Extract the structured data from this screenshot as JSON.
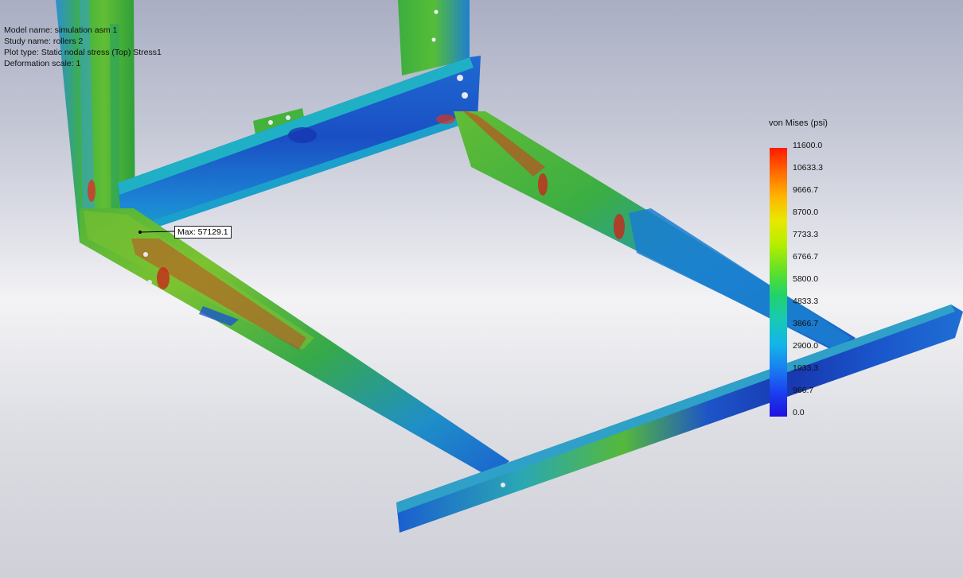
{
  "info": {
    "model_name": "Model name: simulation asm 1",
    "study_name": "Study name: rollers 2",
    "plot_type": "Plot type: Static nodal stress (Top) Stress1",
    "deformation_scale": "Deformation scale: 1"
  },
  "legend": {
    "title": "von Mises (psi)",
    "ticks": [
      "11600.0",
      "10633.3",
      "9666.7",
      "8700.0",
      "7733.3",
      "6766.7",
      "5800.0",
      "4833.3",
      "3866.7",
      "2900.0",
      "1933.3",
      "966.7",
      "0.0"
    ],
    "color_high": "#ff1a00",
    "color_low": "#1f10e0"
  },
  "max_marker": {
    "label": "Max: 57129.1"
  },
  "colors": {
    "frame_green": "#3fb03c",
    "frame_blue": "#1a5fd0",
    "frame_deep_blue": "#1536b0",
    "hotspot_red": "#d8341a"
  }
}
